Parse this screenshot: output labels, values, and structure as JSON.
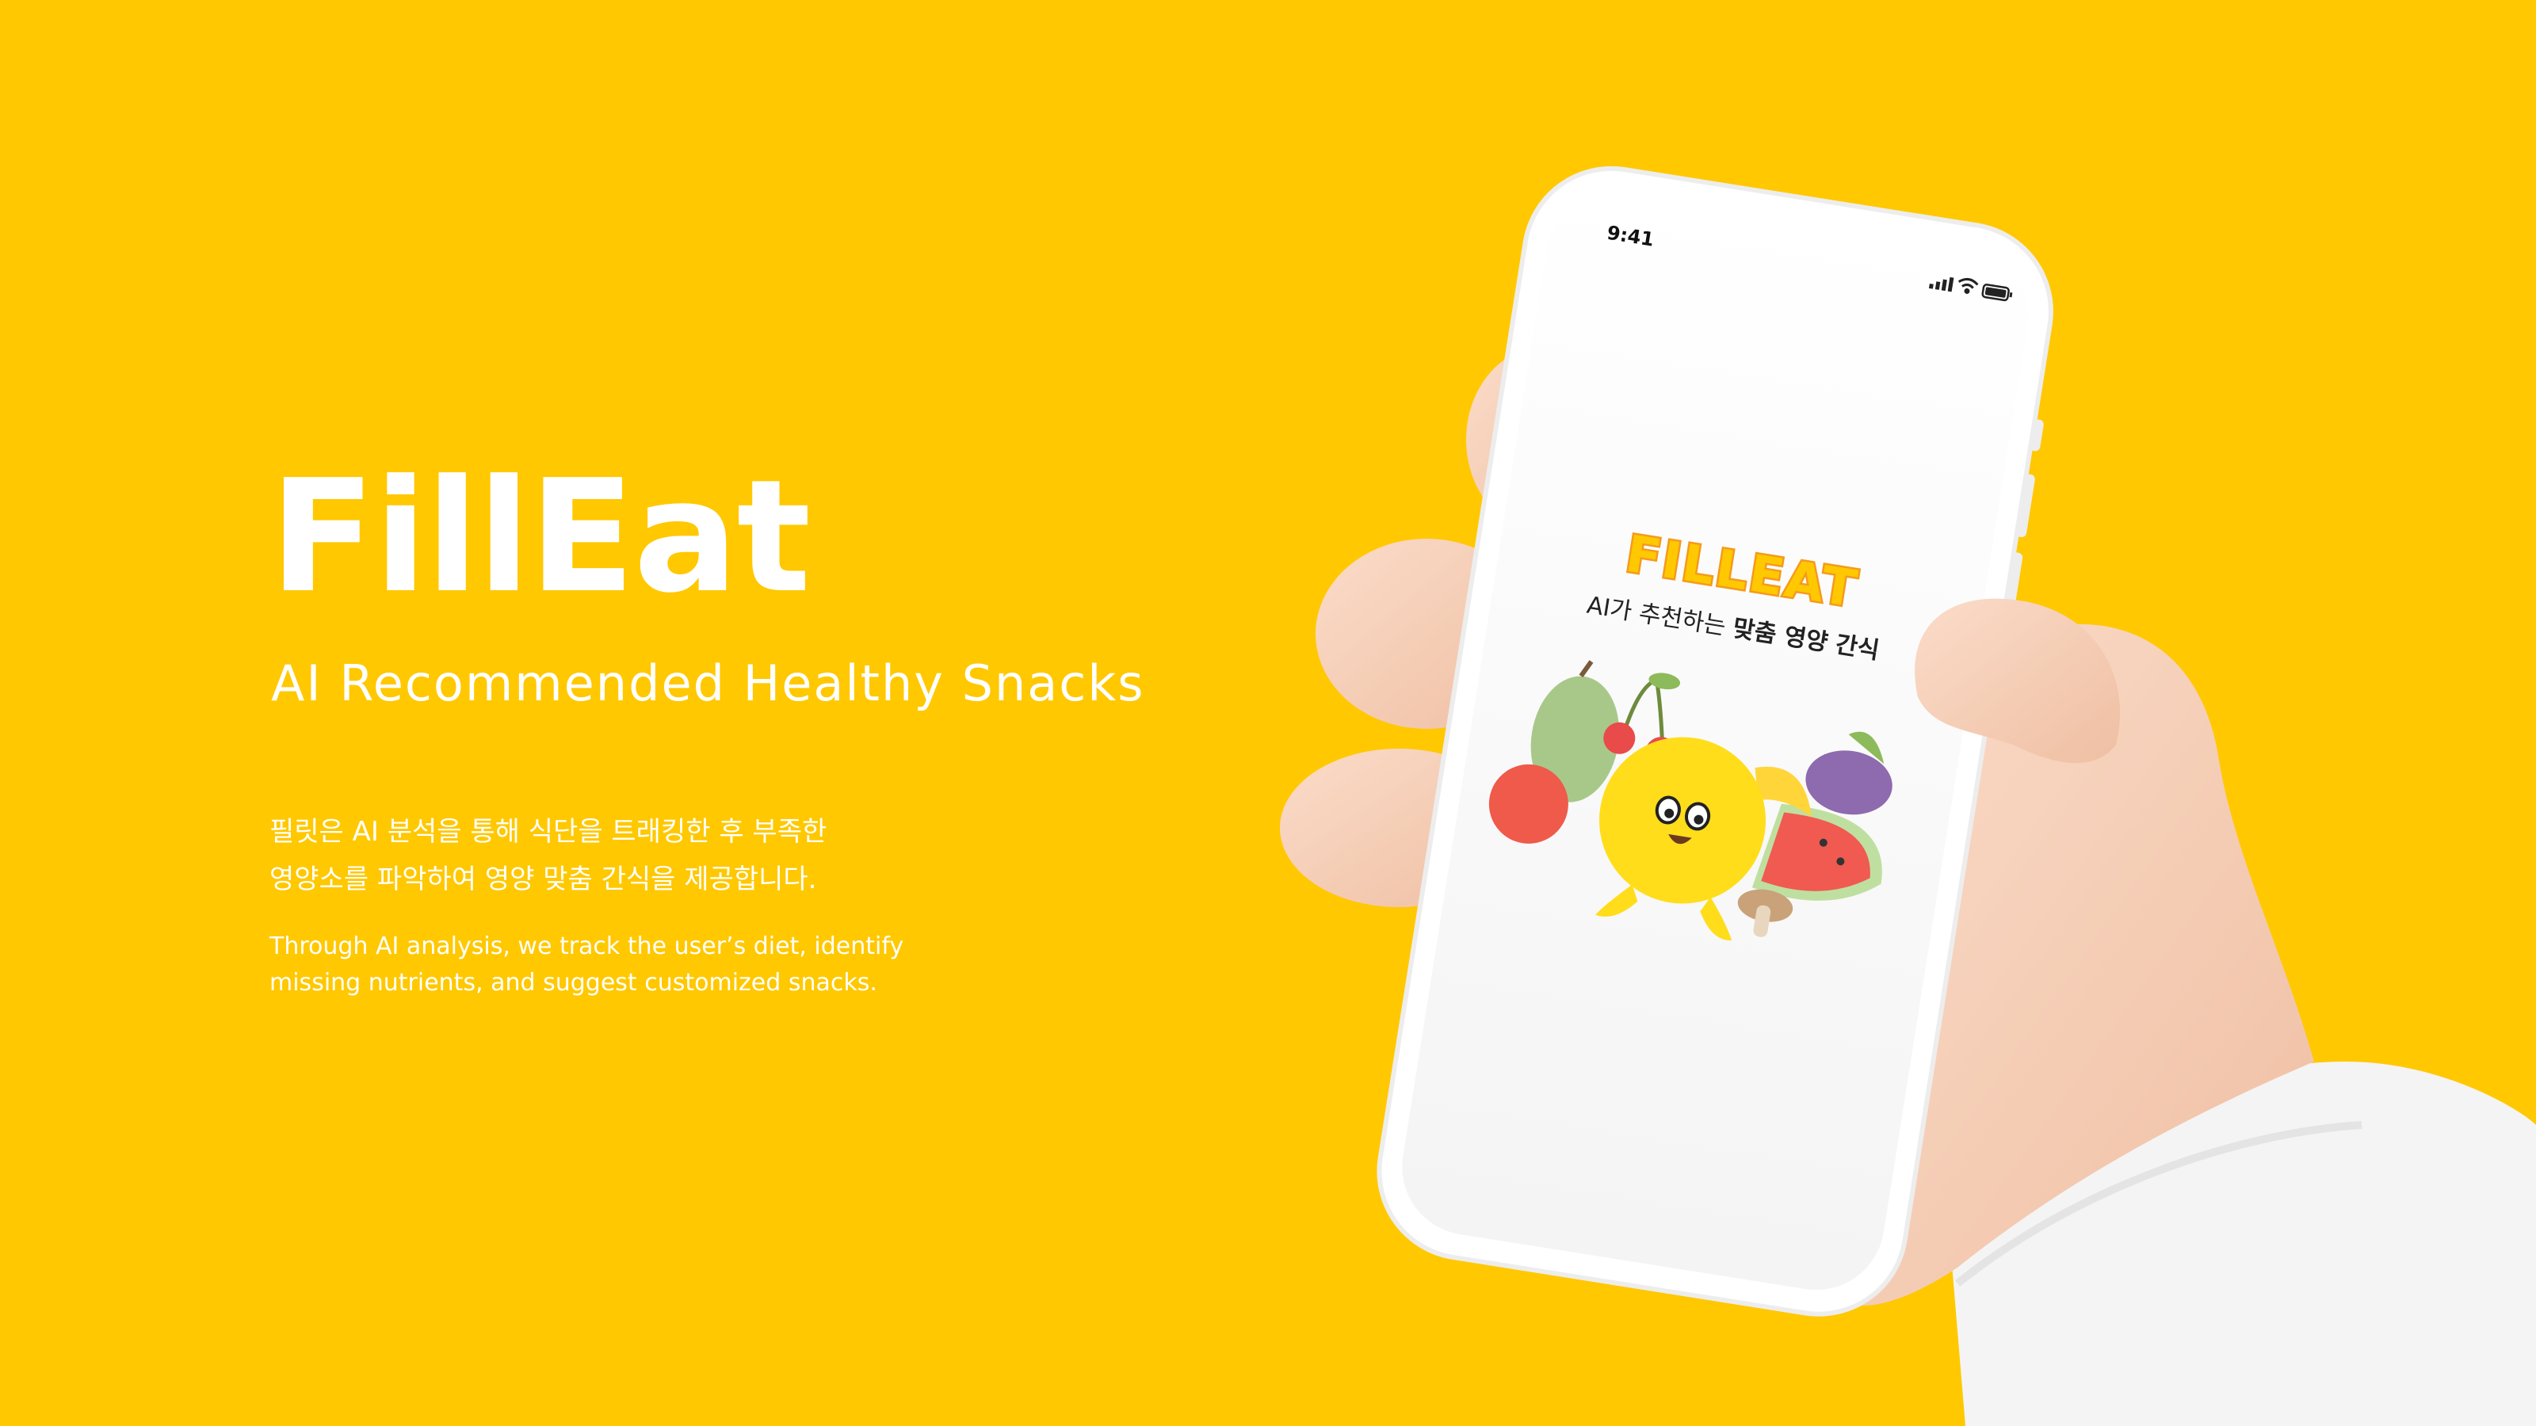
{
  "hero": {
    "title": "FillEat",
    "tagline": "AI Recommended Healthy Snacks",
    "description_ko": [
      "필릿은 AI 분석을 통해 식단을 트래킹한 후 부족한",
      "영양소를 파악하여 영양 맞춤 간식을 제공합니다."
    ],
    "description_en": [
      "Through AI analysis, we track the user’s diet, identify",
      "missing nutrients, and suggest customized snacks."
    ]
  },
  "phone": {
    "status_time": "9:41",
    "app_logo": "FILLEAT",
    "app_tagline_plain": "AI가 추천하는 ",
    "app_tagline_bold": "맞춤 영양 간식"
  },
  "icons": [
    "signal-icon",
    "wifi-icon",
    "battery-icon"
  ],
  "colors": {
    "background": "#FFC800",
    "text": "#FFFFFF",
    "logo_fill": "#FFC800",
    "logo_stroke": "#F59A1C",
    "hand": "#F6CDB6",
    "sleeve": "#F4F4F4"
  }
}
